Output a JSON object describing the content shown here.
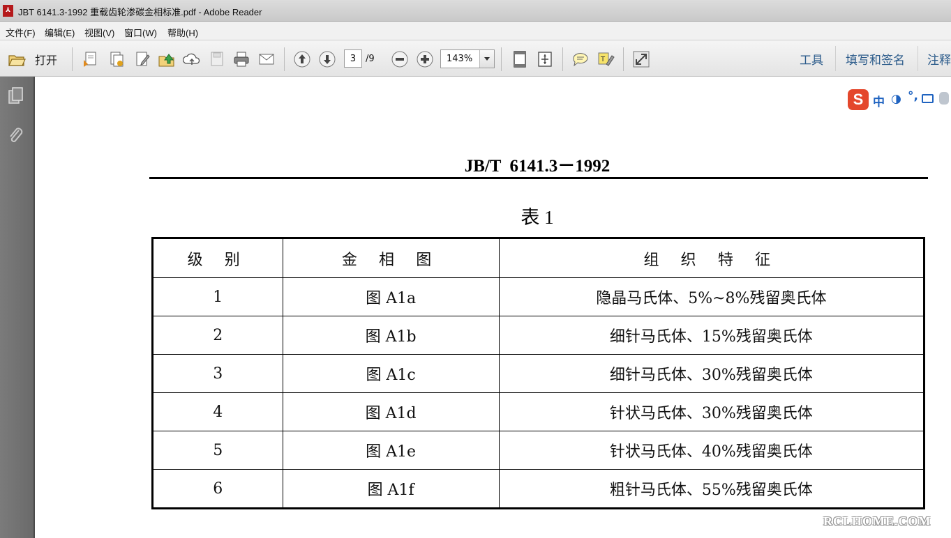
{
  "window": {
    "title": "JBT 6141.3-1992 重载齿轮渗碳金相标准.pdf - Adobe Reader"
  },
  "menu": [
    "文件(F)",
    "编辑(E)",
    "视图(V)",
    "窗口(W)",
    "帮助(H)"
  ],
  "toolbar": {
    "open_label": "打开",
    "page_current": "3",
    "page_total": "/9",
    "zoom": "143%",
    "right_tools": [
      "工具",
      "填写和签名",
      "注释"
    ]
  },
  "ime": {
    "logo": "S",
    "mode": "中",
    "moon": "◑",
    "punct": "°,"
  },
  "document": {
    "header": "JB/T  6141.3－1992",
    "caption": "表 1",
    "columns": [
      "级 别",
      "金 相 图",
      "组 织 特 征"
    ],
    "rows": [
      [
        "1",
        "图 A1a",
        "隐晶马氏体、5%~8%残留奥氏体"
      ],
      [
        "2",
        "图 A1b",
        "细针马氏体、15%残留奥氏体"
      ],
      [
        "3",
        "图 A1c",
        "细针马氏体、30%残留奥氏体"
      ],
      [
        "4",
        "图 A1d",
        "针状马氏体、30%残留奥氏体"
      ],
      [
        "5",
        "图 A1e",
        "针状马氏体、40%残留奥氏体"
      ],
      [
        "6",
        "图 A1f",
        "粗针马氏体、55%残留奥氏体"
      ]
    ]
  },
  "watermark": "RCLHOME.COM",
  "colors": {
    "toolbar_bg": "#e9e9e9",
    "sidebar_bg": "#707070",
    "right_tool_text": "#2a5a8a",
    "ime_logo": "#e4472c",
    "ime_blue": "#1f63c0"
  }
}
